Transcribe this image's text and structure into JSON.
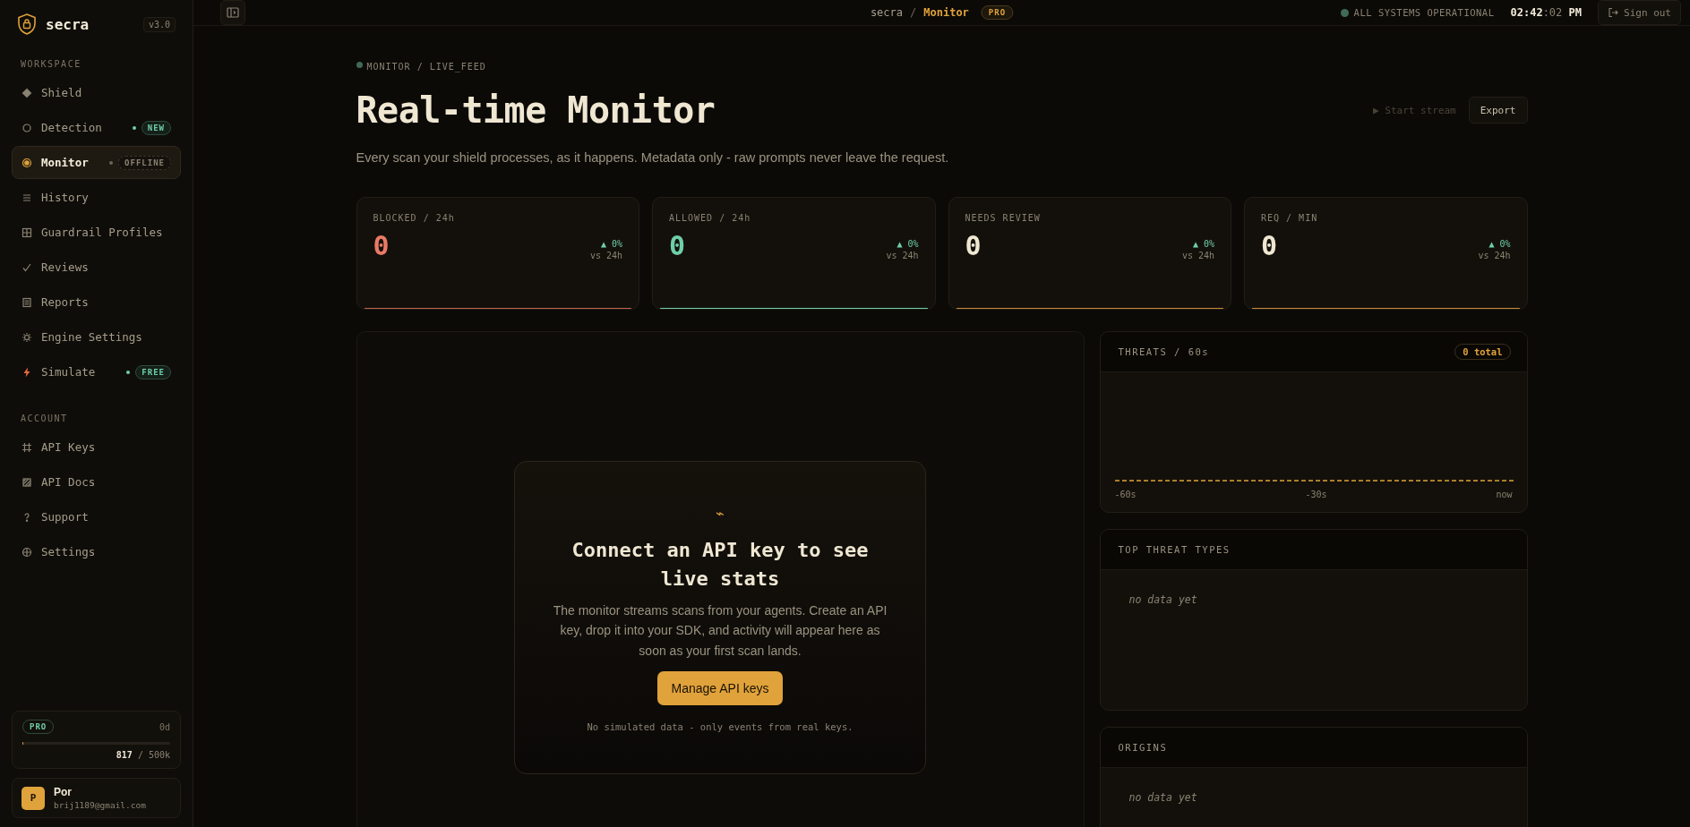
{
  "sidebar": {
    "brand": "secra",
    "version": "v3.0",
    "sections": [
      {
        "heading": "WORKSPACE",
        "items": [
          {
            "label": "Shield",
            "kind": "diamond",
            "selected": false
          },
          {
            "label": "Detection",
            "kind": "circle",
            "selected": false,
            "badge": {
              "text": "NEW",
              "kind": "live"
            }
          },
          {
            "label": "Monitor",
            "kind": "target",
            "selected": true,
            "badge": {
              "text": "OFFLINE",
              "kind": "muted"
            }
          },
          {
            "label": "History",
            "kind": "list",
            "selected": false
          },
          {
            "label": "Guardrail Profiles",
            "kind": "grid",
            "selected": false
          },
          {
            "label": "Reviews",
            "kind": "check",
            "selected": false
          },
          {
            "label": "Reports",
            "kind": "report",
            "selected": false
          },
          {
            "label": "Engine Settings",
            "kind": "gear",
            "selected": false
          },
          {
            "label": "Simulate",
            "kind": "bolt",
            "selected": false,
            "badge": {
              "text": "FREE",
              "kind": "live"
            }
          }
        ]
      },
      {
        "heading": "ACCOUNT",
        "items": [
          {
            "label": "API Keys",
            "kind": "hash",
            "selected": false
          },
          {
            "label": "API Docs",
            "kind": "doc",
            "selected": false
          },
          {
            "label": "Support",
            "kind": "question",
            "selected": false
          },
          {
            "label": "Settings",
            "kind": "globe",
            "selected": false
          }
        ]
      }
    ],
    "plan": {
      "name": "PRO",
      "days": "0d",
      "used": "817",
      "limit": "/ 500k",
      "level": 0.0016
    },
    "user": {
      "initial": "P",
      "name": "Por",
      "email": "brij1189@gmail.com"
    }
  },
  "topbar": {
    "crumb_root": "secra",
    "crumb_sep": "/",
    "crumb_page": "Monitor",
    "tier": "PRO",
    "status": "ALL SYSTEMS OPERATIONAL",
    "clock": "02:42",
    "clock_seconds": ":02",
    "clock_period": "PM",
    "sign_out": "Sign out"
  },
  "header": {
    "eyebrow": "MONITOR / LIVE_FEED",
    "title": "Real-time Monitor",
    "subtitle": "Every scan your shield processes, as it happens. Metadata only - raw prompts never leave the request.",
    "start_stream": {
      "label": "▶ Start stream",
      "disabled": true
    },
    "export": "Export"
  },
  "stats": [
    {
      "label": "BLOCKED / 24h",
      "value": "0",
      "kind": "danger",
      "delta": "▲ 0%",
      "compare": "vs 24h"
    },
    {
      "label": "ALLOWED / 24h",
      "value": "0",
      "kind": "success",
      "delta": "▲ 0%",
      "compare": "vs 24h"
    },
    {
      "label": "NEEDS REVIEW",
      "value": "0",
      "kind": "warning",
      "delta": "▲ 0%",
      "compare": "vs 24h"
    },
    {
      "label": "REQ / MIN",
      "value": "0",
      "kind": "neutral",
      "delta": "▲ 0%",
      "compare": "vs 24h"
    }
  ],
  "empty_state": {
    "icon": "⌁",
    "title": "Connect an API key to see live stats",
    "body": "The monitor streams scans from your agents. Create an API key, drop it into your SDK, and activity will appear here as soon as your first scan lands.",
    "button": "Manage API keys",
    "note": "No simulated data - only events from real keys."
  },
  "threats": {
    "title": "THREATS / 60s",
    "total": "0 total",
    "axis_labels": [
      "-60s",
      "-30s",
      "now"
    ]
  },
  "top_threat_types": {
    "title": "TOP THREAT TYPES",
    "empty": "no data yet"
  },
  "origins": {
    "title": "ORIGINS",
    "empty": "no data yet"
  }
}
